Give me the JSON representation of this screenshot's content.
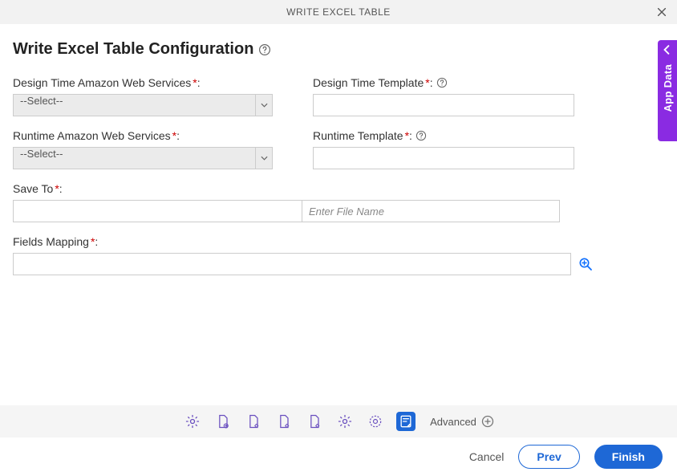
{
  "titlebar": {
    "title": "WRITE EXCEL TABLE"
  },
  "heading": "Write Excel Table Configuration",
  "sidePanel": {
    "label": "App Data"
  },
  "labels": {
    "designTimeAws": "Design Time Amazon Web Services",
    "runtimeAws": "Runtime Amazon Web Services",
    "designTimeTemplate": "Design Time Template",
    "runtimeTemplate": "Runtime Template",
    "saveTo": "Save To",
    "fieldsMapping": "Fields Mapping",
    "colon": ":",
    "star": "*"
  },
  "placeholders": {
    "select": "--Select--",
    "fileName": "Enter File Name"
  },
  "values": {
    "designTimeAws": "--Select--",
    "runtimeAws": "--Select--",
    "designTimeTemplate": "",
    "runtimeTemplate": "",
    "saveToPath": "",
    "saveToFile": "",
    "fieldsMapping": ""
  },
  "nav": {
    "advanced": "Advanced"
  },
  "footer": {
    "cancel": "Cancel",
    "prev": "Prev",
    "finish": "Finish"
  }
}
